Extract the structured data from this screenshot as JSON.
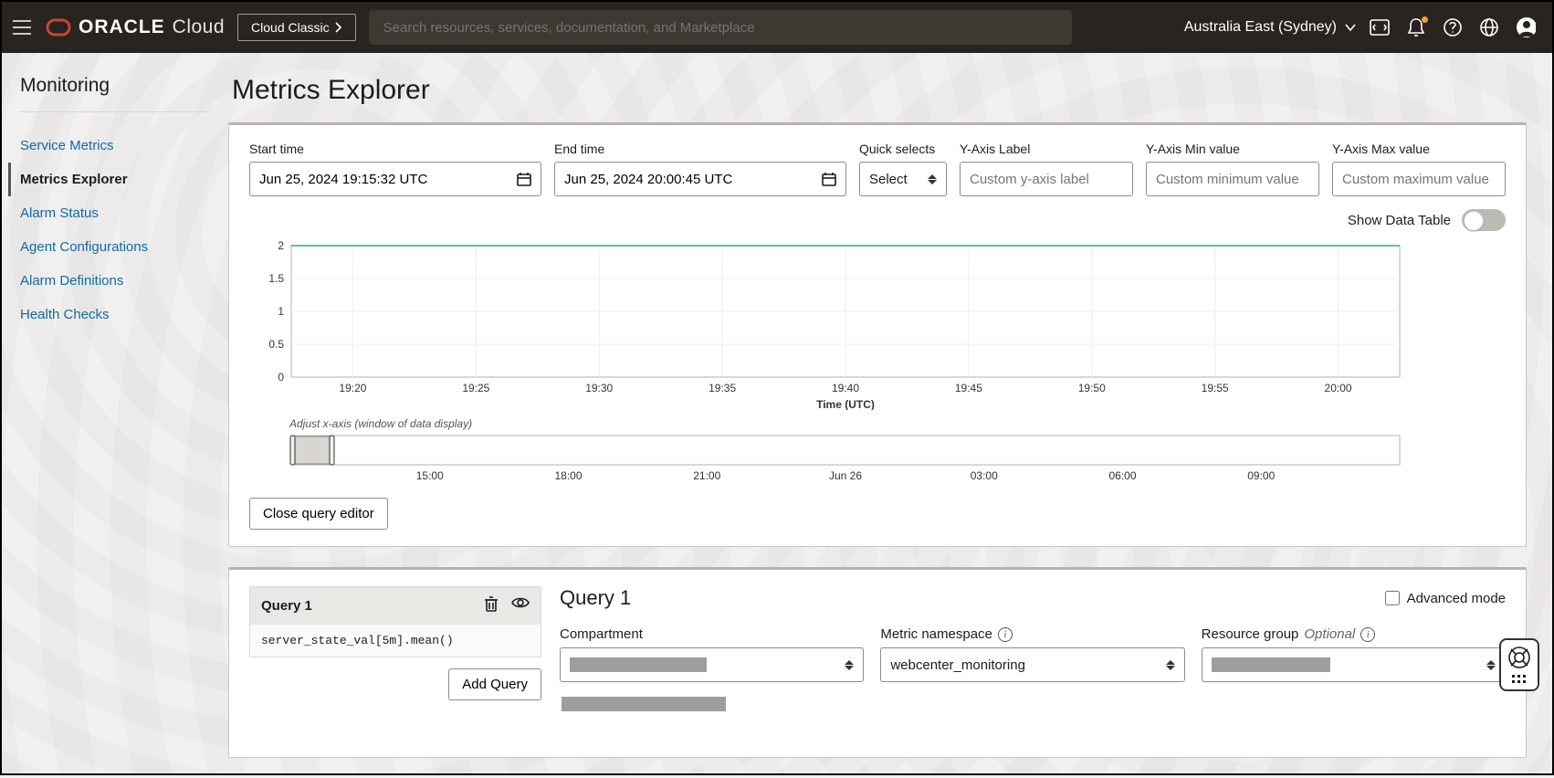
{
  "header": {
    "logo_mark": "ORACLE",
    "logo_cloud": "Cloud",
    "cloud_classic": "Cloud Classic",
    "search_placeholder": "Search resources, services, documentation, and Marketplace",
    "region": "Australia East (Sydney)"
  },
  "sidebar": {
    "title": "Monitoring",
    "items": [
      {
        "label": "Service Metrics",
        "active": false
      },
      {
        "label": "Metrics Explorer",
        "active": true
      },
      {
        "label": "Alarm Status",
        "active": false
      },
      {
        "label": "Agent Configurations",
        "active": false
      },
      {
        "label": "Alarm Definitions",
        "active": false
      },
      {
        "label": "Health Checks",
        "active": false
      }
    ]
  },
  "page": {
    "title": "Metrics Explorer",
    "controls": {
      "start_label": "Start time",
      "start_value": "Jun 25, 2024 19:15:32 UTC",
      "end_label": "End time",
      "end_value": "Jun 25, 2024 20:00:45 UTC",
      "quick_label": "Quick selects",
      "quick_value": "Select",
      "yaxis_label_label": "Y-Axis Label",
      "yaxis_label_ph": "Custom y-axis label",
      "yaxis_min_label": "Y-Axis Min value",
      "yaxis_min_ph": "Custom minimum value",
      "yaxis_max_label": "Y-Axis Max value",
      "yaxis_max_ph": "Custom maximum value"
    },
    "toggle_label": "Show Data Table",
    "adjust_label": "Adjust x-axis (window of data display)",
    "close_editor": "Close query editor"
  },
  "chart_data": {
    "type": "line",
    "xlabel": "Time (UTC)",
    "ylim": [
      0,
      2
    ],
    "y_ticks": [
      0,
      0.5,
      1,
      1.5,
      2
    ],
    "x_ticks": [
      "19:20",
      "19:25",
      "19:30",
      "19:35",
      "19:40",
      "19:45",
      "19:50",
      "19:55",
      "20:00"
    ],
    "series": [
      {
        "name": "server_state_val",
        "value_constant": 2,
        "color": "#2aa6a0"
      }
    ],
    "brush_ticks": [
      "15:00",
      "18:00",
      "21:00",
      "Jun 26",
      "03:00",
      "06:00",
      "09:00"
    ]
  },
  "query": {
    "side_title": "Query 1",
    "code": "server_state_val[5m].mean()",
    "add_query": "Add Query",
    "main_title": "Query 1",
    "advanced_label": "Advanced mode",
    "compartment_label": "Compartment",
    "namespace_label": "Metric namespace",
    "namespace_value": "webcenter_monitoring",
    "resource_group_label": "Resource group",
    "optional": "Optional"
  }
}
